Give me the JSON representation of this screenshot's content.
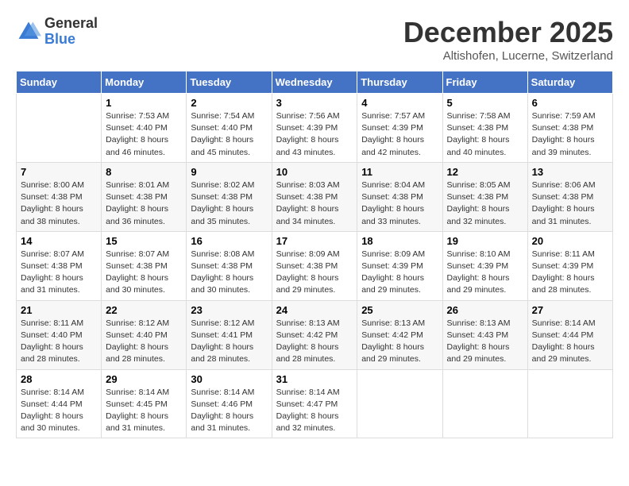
{
  "header": {
    "logo_general": "General",
    "logo_blue": "Blue",
    "month_title": "December 2025",
    "location": "Altishofen, Lucerne, Switzerland"
  },
  "days_of_week": [
    "Sunday",
    "Monday",
    "Tuesday",
    "Wednesday",
    "Thursday",
    "Friday",
    "Saturday"
  ],
  "weeks": [
    [
      {
        "day": "",
        "info": ""
      },
      {
        "day": "1",
        "info": "Sunrise: 7:53 AM\nSunset: 4:40 PM\nDaylight: 8 hours\nand 46 minutes."
      },
      {
        "day": "2",
        "info": "Sunrise: 7:54 AM\nSunset: 4:40 PM\nDaylight: 8 hours\nand 45 minutes."
      },
      {
        "day": "3",
        "info": "Sunrise: 7:56 AM\nSunset: 4:39 PM\nDaylight: 8 hours\nand 43 minutes."
      },
      {
        "day": "4",
        "info": "Sunrise: 7:57 AM\nSunset: 4:39 PM\nDaylight: 8 hours\nand 42 minutes."
      },
      {
        "day": "5",
        "info": "Sunrise: 7:58 AM\nSunset: 4:38 PM\nDaylight: 8 hours\nand 40 minutes."
      },
      {
        "day": "6",
        "info": "Sunrise: 7:59 AM\nSunset: 4:38 PM\nDaylight: 8 hours\nand 39 minutes."
      }
    ],
    [
      {
        "day": "7",
        "info": ""
      },
      {
        "day": "8",
        "info": "Sunrise: 8:01 AM\nSunset: 4:38 PM\nDaylight: 8 hours\nand 36 minutes."
      },
      {
        "day": "9",
        "info": "Sunrise: 8:02 AM\nSunset: 4:38 PM\nDaylight: 8 hours\nand 35 minutes."
      },
      {
        "day": "10",
        "info": "Sunrise: 8:03 AM\nSunset: 4:38 PM\nDaylight: 8 hours\nand 34 minutes."
      },
      {
        "day": "11",
        "info": "Sunrise: 8:04 AM\nSunset: 4:38 PM\nDaylight: 8 hours\nand 33 minutes."
      },
      {
        "day": "12",
        "info": "Sunrise: 8:05 AM\nSunset: 4:38 PM\nDaylight: 8 hours\nand 32 minutes."
      },
      {
        "day": "13",
        "info": "Sunrise: 8:06 AM\nSunset: 4:38 PM\nDaylight: 8 hours\nand 31 minutes."
      }
    ],
    [
      {
        "day": "14",
        "info": ""
      },
      {
        "day": "15",
        "info": "Sunrise: 8:07 AM\nSunset: 4:38 PM\nDaylight: 8 hours\nand 30 minutes."
      },
      {
        "day": "16",
        "info": "Sunrise: 8:08 AM\nSunset: 4:38 PM\nDaylight: 8 hours\nand 30 minutes."
      },
      {
        "day": "17",
        "info": "Sunrise: 8:09 AM\nSunset: 4:38 PM\nDaylight: 8 hours\nand 29 minutes."
      },
      {
        "day": "18",
        "info": "Sunrise: 8:09 AM\nSunset: 4:39 PM\nDaylight: 8 hours\nand 29 minutes."
      },
      {
        "day": "19",
        "info": "Sunrise: 8:10 AM\nSunset: 4:39 PM\nDaylight: 8 hours\nand 29 minutes."
      },
      {
        "day": "20",
        "info": "Sunrise: 8:11 AM\nSunset: 4:39 PM\nDaylight: 8 hours\nand 28 minutes."
      }
    ],
    [
      {
        "day": "21",
        "info": ""
      },
      {
        "day": "22",
        "info": "Sunrise: 8:12 AM\nSunset: 4:40 PM\nDaylight: 8 hours\nand 28 minutes."
      },
      {
        "day": "23",
        "info": "Sunrise: 8:12 AM\nSunset: 4:41 PM\nDaylight: 8 hours\nand 28 minutes."
      },
      {
        "day": "24",
        "info": "Sunrise: 8:13 AM\nSunset: 4:42 PM\nDaylight: 8 hours\nand 28 minutes."
      },
      {
        "day": "25",
        "info": "Sunrise: 8:13 AM\nSunset: 4:42 PM\nDaylight: 8 hours\nand 29 minutes."
      },
      {
        "day": "26",
        "info": "Sunrise: 8:13 AM\nSunset: 4:43 PM\nDaylight: 8 hours\nand 29 minutes."
      },
      {
        "day": "27",
        "info": "Sunrise: 8:14 AM\nSunset: 4:44 PM\nDaylight: 8 hours\nand 29 minutes."
      }
    ],
    [
      {
        "day": "28",
        "info": "Sunrise: 8:14 AM\nSunset: 4:44 PM\nDaylight: 8 hours\nand 30 minutes."
      },
      {
        "day": "29",
        "info": "Sunrise: 8:14 AM\nSunset: 4:45 PM\nDaylight: 8 hours\nand 31 minutes."
      },
      {
        "day": "30",
        "info": "Sunrise: 8:14 AM\nSunset: 4:46 PM\nDaylight: 8 hours\nand 31 minutes."
      },
      {
        "day": "31",
        "info": "Sunrise: 8:14 AM\nSunset: 4:47 PM\nDaylight: 8 hours\nand 32 minutes."
      },
      {
        "day": "",
        "info": ""
      },
      {
        "day": "",
        "info": ""
      },
      {
        "day": "",
        "info": ""
      }
    ]
  ],
  "week7_sunday": "Sunrise: 8:00 AM\nSunset: 4:38 PM\nDaylight: 8 hours\nand 38 minutes.",
  "week14_sunday": "Sunrise: 8:07 AM\nSunset: 4:38 PM\nDaylight: 8 hours\nand 31 minutes.",
  "week21_sunday": "Sunrise: 8:11 AM\nSunset: 4:40 PM\nDaylight: 8 hours\nand 28 minutes."
}
